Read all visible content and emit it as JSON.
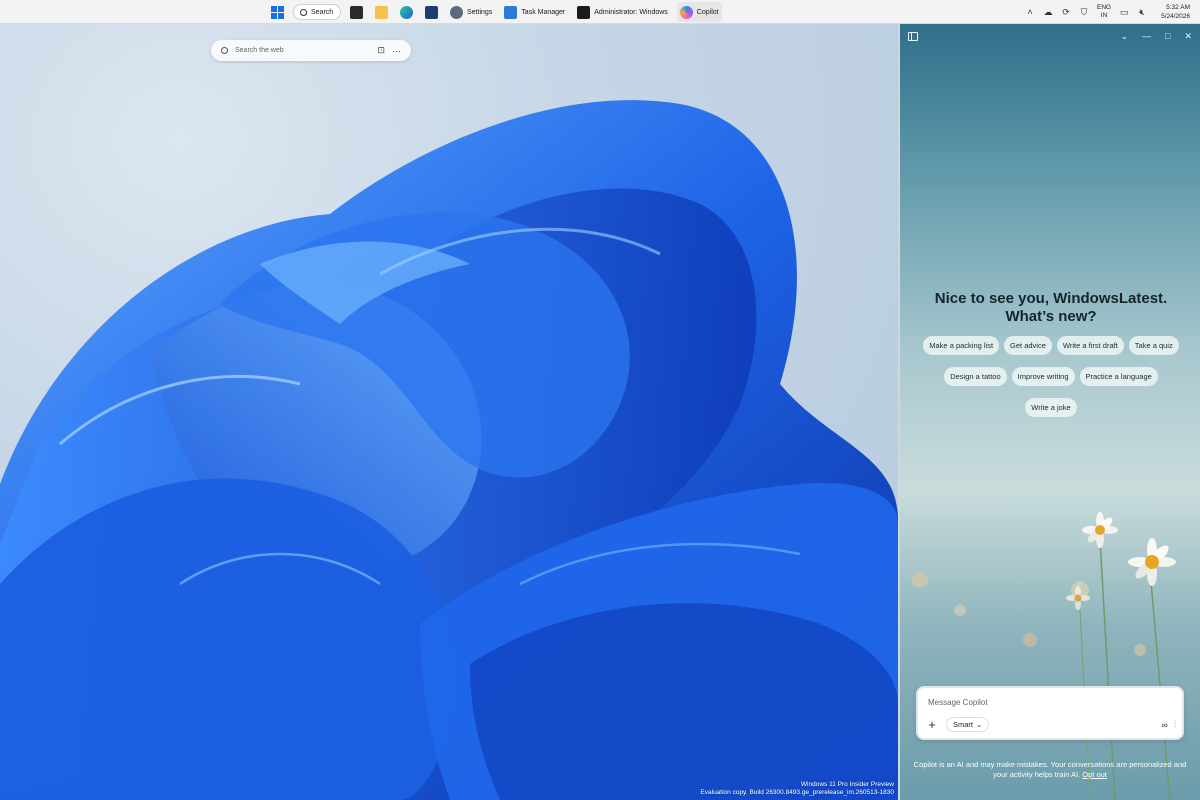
{
  "taskbar": {
    "search_label": "Search",
    "apps": [
      {
        "label": "Settings"
      },
      {
        "label": "Task Manager"
      },
      {
        "label": "Administrator: Windows"
      },
      {
        "label": "Copilot"
      }
    ],
    "language": "ENG",
    "region": "IN",
    "time": "5:32 AM",
    "date": "5/24/2026"
  },
  "desktop": {
    "search_placeholder": "Search the web",
    "watermark_line1": "Windows 11 Pro Insider Preview",
    "watermark_line2": "Evaluation copy. Build 26300.8493.ge_prerelease_im.260513-1830"
  },
  "copilot": {
    "greeting": "Nice to see you, WindowsLatest. What’s new?",
    "chips_row1": [
      "Make a packing list",
      "Get advice",
      "Write a first draft",
      "Take a quiz"
    ],
    "chips_row2": [
      "Design a tattoo",
      "Improve writing",
      "Practice a language"
    ],
    "chips_row3": [
      "Write a joke"
    ],
    "composer_placeholder": "Message Copilot",
    "mode_label": "Smart",
    "disclaimer": "Copilot is an AI and may make mistakes. Your conversations are personalized and your activity helps train AI.",
    "opt_out": "Opt out"
  },
  "colors": {
    "accent": "#1a6fe0",
    "bloom": "#1e63e6"
  }
}
